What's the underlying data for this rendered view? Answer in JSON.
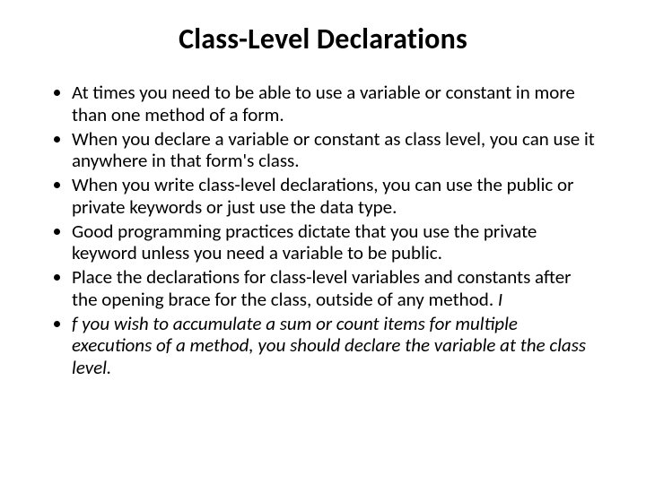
{
  "slide": {
    "title": "Class-Level Declarations",
    "bullets": [
      {
        "text": "At times you need to be able to use a variable or constant in more than one method of a form."
      },
      {
        "text": "When you declare a variable or constant as class level, you can use it anywhere in that form's class."
      },
      {
        "text": "When you write class-level declarations, you can use the public or private keywords or just use the data type."
      },
      {
        "text": "Good programming practices dictate that you use the private keyword unless you need a variable to be public."
      },
      {
        "text": "Place the declarations for class-level variables and constants after the opening brace for the class, outside of any method. ",
        "trailing_italic": "I"
      },
      {
        "italic_text": "f you wish to accumulate a sum or count items for multiple executions of a method, you should declare the variable at the class level."
      }
    ]
  }
}
